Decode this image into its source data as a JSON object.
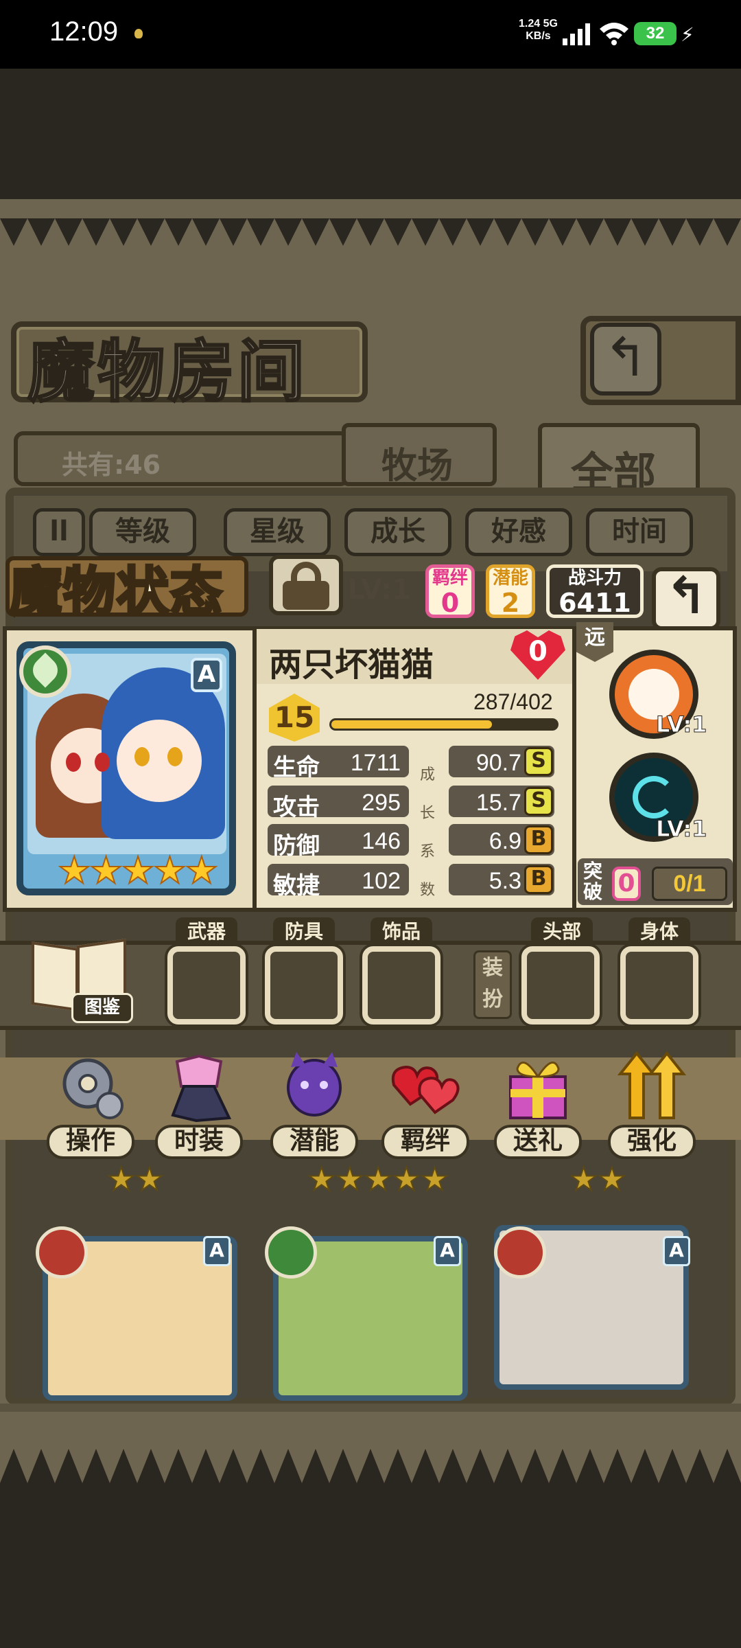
{
  "status_bar": {
    "time": "12:09",
    "net_speed_value": "1.24 5G",
    "net_speed_unit": "KB/s",
    "battery": "32"
  },
  "room": {
    "title": "魔物房间",
    "return_icon": "↰",
    "count_text": "共有:46",
    "tabs": [
      "牧场",
      "全部"
    ],
    "active_tab": "全部"
  },
  "sort": {
    "pause_icon": "ll",
    "buttons": [
      "等级",
      "星级",
      "成长",
      "好感",
      "时间"
    ]
  },
  "status_panel": {
    "title": "魔物状态",
    "lv_tag": "LV:1",
    "bond": {
      "label": "羁绊",
      "value": "0"
    },
    "potential": {
      "label": "潜能",
      "value": "2"
    },
    "power": {
      "label": "战斗力",
      "value": "6411"
    },
    "back_icon": "↰"
  },
  "monster": {
    "name": "两只坏猫猫",
    "affection": "0",
    "rank": "A",
    "element": "leaf",
    "stars": "★★★★★",
    "level": "15",
    "exp_text": "287/402",
    "exp_fraction": 0.714,
    "stats": [
      {
        "name": "生命",
        "value": "1711",
        "growth": "90.7",
        "grade": "S"
      },
      {
        "name": "攻击",
        "value": "295",
        "growth": "15.7",
        "grade": "S"
      },
      {
        "name": "防御",
        "value": "146",
        "growth": "6.9",
        "grade": "B"
      },
      {
        "name": "敏捷",
        "value": "102",
        "growth": "5.3",
        "grade": "B"
      }
    ],
    "growth_chars": [
      "成",
      "长",
      "系",
      "数"
    ]
  },
  "skills": {
    "range": "远",
    "items": [
      {
        "lv": "LV:1",
        "icon": "explosion-icon"
      },
      {
        "lv": "LV:1",
        "icon": "vortex-icon"
      }
    ],
    "break_label": "突破",
    "break_count": "0",
    "break_progress": "0/1"
  },
  "equipment": {
    "dex_label": "图鉴",
    "slots": [
      "武器",
      "防具",
      "饰品",
      "头部",
      "身体"
    ],
    "outfit_label": "装扮"
  },
  "actions": [
    {
      "label": "操作",
      "icon": "gear-icon"
    },
    {
      "label": "时装",
      "icon": "outfit-icon"
    },
    {
      "label": "潜能",
      "icon": "demon-icon"
    },
    {
      "label": "羁绊",
      "icon": "hearts-icon"
    },
    {
      "label": "送礼",
      "icon": "gift-icon"
    },
    {
      "label": "强化",
      "icon": "arrows-up-icon"
    }
  ],
  "grid": {
    "stars_1": "★★",
    "stars_2": "★★★★★",
    "stars_3": "★★",
    "rank": "A"
  },
  "colors": {
    "pink_accent": "#e35c96",
    "gold_accent": "#f2c032",
    "grade_s": "#e6e34a",
    "grade_b": "#e8a830"
  }
}
